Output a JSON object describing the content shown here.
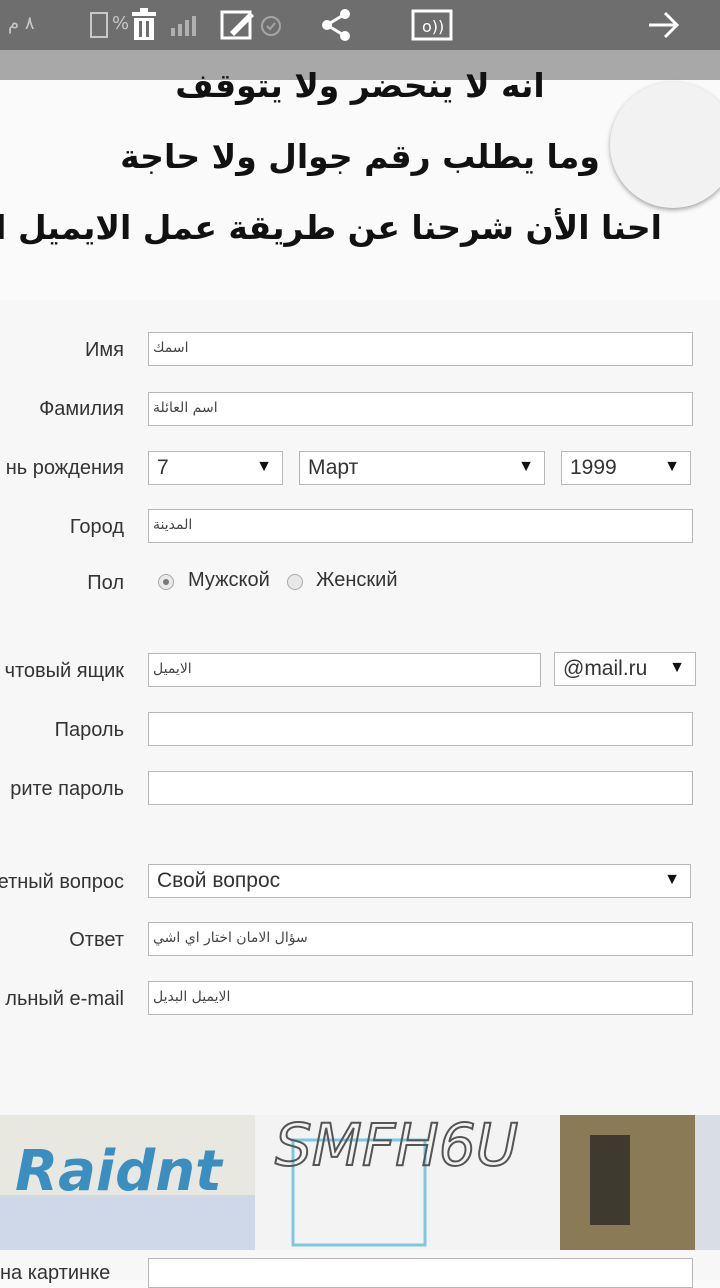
{
  "status": {
    "time": "٨ م",
    "battery_pct": "%",
    "icons": [
      "battery-icon",
      "signal-icon",
      "alarm-icon",
      "notification-icon"
    ]
  },
  "toolbar": {
    "icons": [
      "delete-icon",
      "edit-icon",
      "share-icon",
      "cast-icon",
      "forward-arrow-icon"
    ]
  },
  "caption": {
    "line1": "انه لا ينحضر ولا يتوقف",
    "line2": "وما يطلب رقم جوال ولا حاجة",
    "line3": "احنا الأن شرحنا عن طريقة عمل الايميل الـ"
  },
  "form": {
    "name": {
      "label": "Имя",
      "value": "اسمك"
    },
    "surname": {
      "label": "Фамилия",
      "value": "اسم العائلة"
    },
    "birthday": {
      "label": "нь рождения",
      "day": "7",
      "month": "Март",
      "year": "1999"
    },
    "city": {
      "label": "Город",
      "value": "المدينة"
    },
    "gender": {
      "label": "Пол",
      "male": "Мужской",
      "female": "Женский",
      "selected": "male"
    },
    "mailbox": {
      "label": "чтовый ящик",
      "value": "الايميل",
      "domain": "@mail.ru"
    },
    "password": {
      "label": "Пароль",
      "value": ""
    },
    "password_repeat": {
      "label": "рите пароль",
      "value": ""
    },
    "secret_question": {
      "label": "етный вопрос",
      "value": "Свой вопрос"
    },
    "answer": {
      "label": "Ответ",
      "value": "سؤال الامان اختار اي اشي"
    },
    "alt_email": {
      "label": "льный e-mail",
      "value": "الايميل البديل"
    },
    "captcha": {
      "label": "на картинке"
    }
  },
  "footer": {
    "logo_text": "Raidnt",
    "captcha_text": "SMFH6U"
  }
}
